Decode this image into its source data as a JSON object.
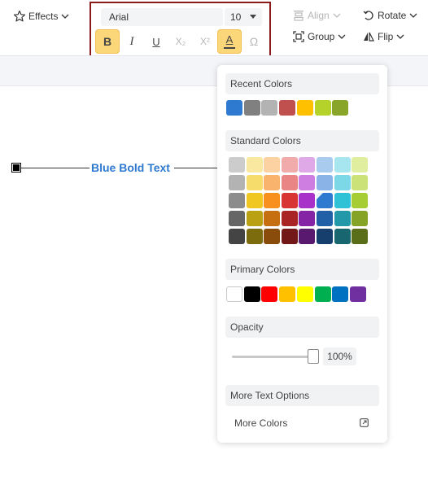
{
  "toolbar": {
    "effects_label": "Effects",
    "align_label": "Align",
    "rotate_label": "Rotate",
    "group_label": "Group",
    "flip_label": "Flip",
    "font_family": "Arial",
    "font_size": "10",
    "format_buttons": {
      "bold": "B",
      "italic": "I",
      "underline": "U",
      "subscript": "X₂",
      "superscript": "X²",
      "font_color": "A",
      "special_char": "Ω"
    }
  },
  "canvas": {
    "text": "Blue Bold Text",
    "text_color": "#2e7ad1"
  },
  "color_panel": {
    "recent_title": "Recent Colors",
    "recent_colors": [
      "#2e7ad1",
      "#808080",
      "#b3b3b3",
      "#c0504d",
      "#ffc000",
      "#b5d22b",
      "#8aa62a"
    ],
    "standard_title": "Standard Colors",
    "standard_colors": [
      [
        "#cccccc",
        "#f9e9a0",
        "#fcd2a3",
        "#f2abab",
        "#dfa9e8",
        "#a9cbee",
        "#a7e6ef",
        "#e0ee9f"
      ],
      [
        "#b3b3b3",
        "#f5dc6b",
        "#f9b36c",
        "#ea8585",
        "#cd7ee0",
        "#8ab4e8",
        "#7cd8e6",
        "#cbe278"
      ],
      [
        "#8c8c8c",
        "#f0c720",
        "#f7901e",
        "#d93434",
        "#a832c9",
        "#2e7ad1",
        "#2fc1d6",
        "#a6cd33"
      ],
      [
        "#666666",
        "#baa114",
        "#c66f11",
        "#a92525",
        "#8525a5",
        "#2160a7",
        "#2398a8",
        "#85a327"
      ],
      [
        "#444444",
        "#7d6c0e",
        "#8a4c0b",
        "#721818",
        "#59196f",
        "#163f6e",
        "#186670",
        "#5a6e1a"
      ]
    ],
    "primary_title": "Primary Colors",
    "primary_colors": [
      "#ffffff",
      "#000000",
      "#ff0000",
      "#ffc000",
      "#ffff00",
      "#00b050",
      "#0070c0",
      "#7030a0"
    ],
    "opacity_title": "Opacity",
    "opacity_value": "100%",
    "more_text_options": "More Text Options",
    "more_colors": "More Colors"
  }
}
